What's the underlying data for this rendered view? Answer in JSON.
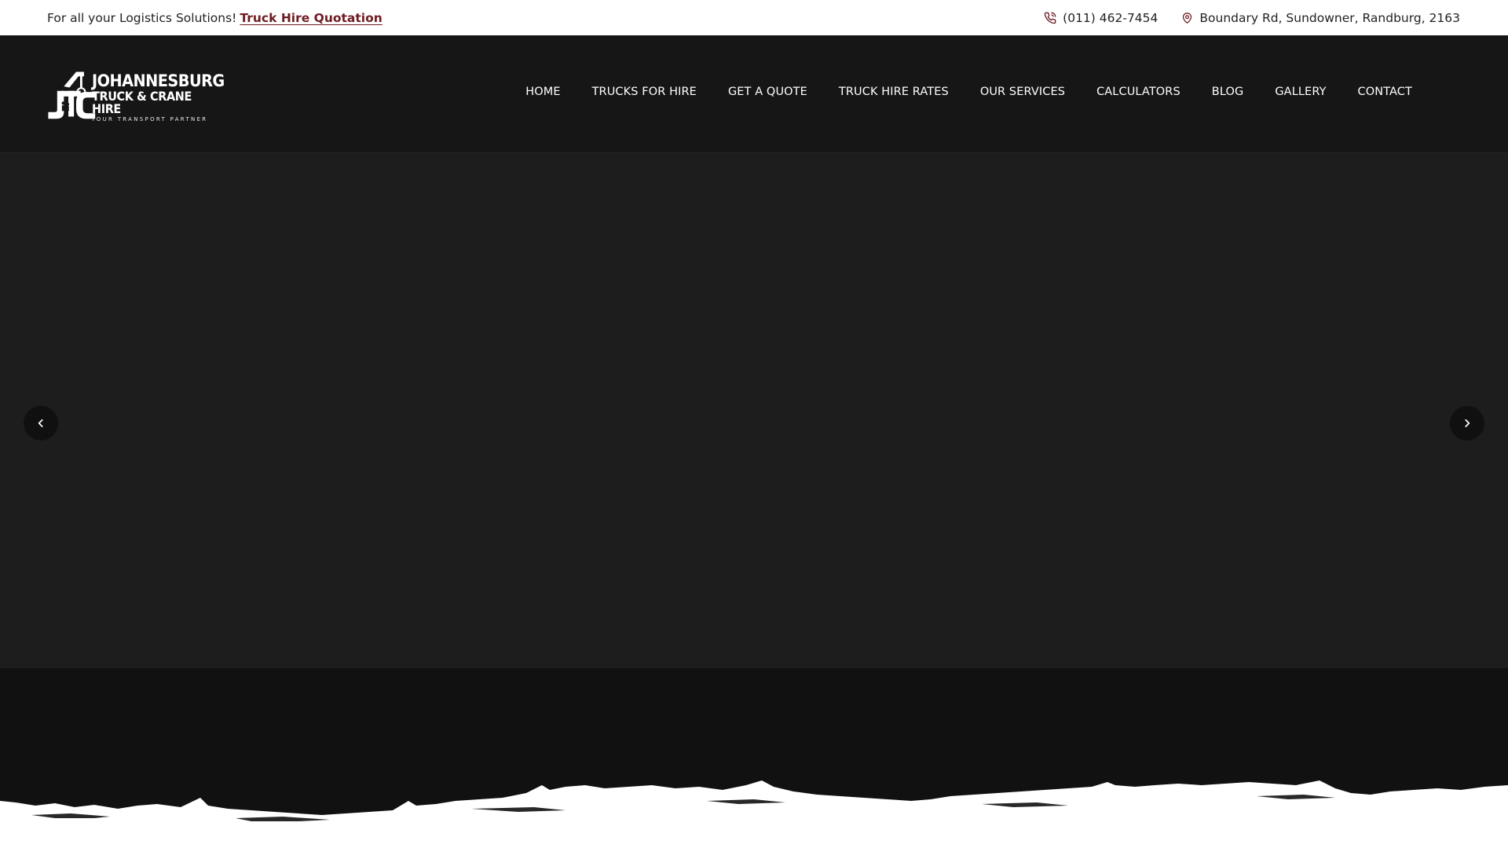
{
  "topbar": {
    "tagline": "For all your Logistics Solutions!",
    "quote_link": "Truck Hire Quotation",
    "phone": "(011) 462-7454",
    "address": "Boundary Rd, Sundowner, Randburg, 2163",
    "icons": [
      "phone-icon",
      "location-pin-icon"
    ],
    "accent_color": "#6e1b22"
  },
  "logo": {
    "line1": "JOHANNESBURG",
    "line2": "TRUCK & CRANE HIRE",
    "line3": "YOUR TRANSPORT PARTNER",
    "monogram": "JTC"
  },
  "nav": {
    "items": [
      "HOME",
      "TRUCKS FOR HIRE",
      "GET A QUOTE",
      "TRUCK HIRE RATES",
      "OUR SERVICES",
      "CALCULATORS",
      "BLOG",
      "GALLERY",
      "CONTACT"
    ]
  },
  "slider": {
    "prev_icon": "chevron-left-icon",
    "next_icon": "chevron-right-icon"
  },
  "colors": {
    "header_bg": "#161616",
    "hero_bg": "#1d1d1d",
    "lower_bg": "#111111",
    "topbar_bg": "#ffffff"
  }
}
